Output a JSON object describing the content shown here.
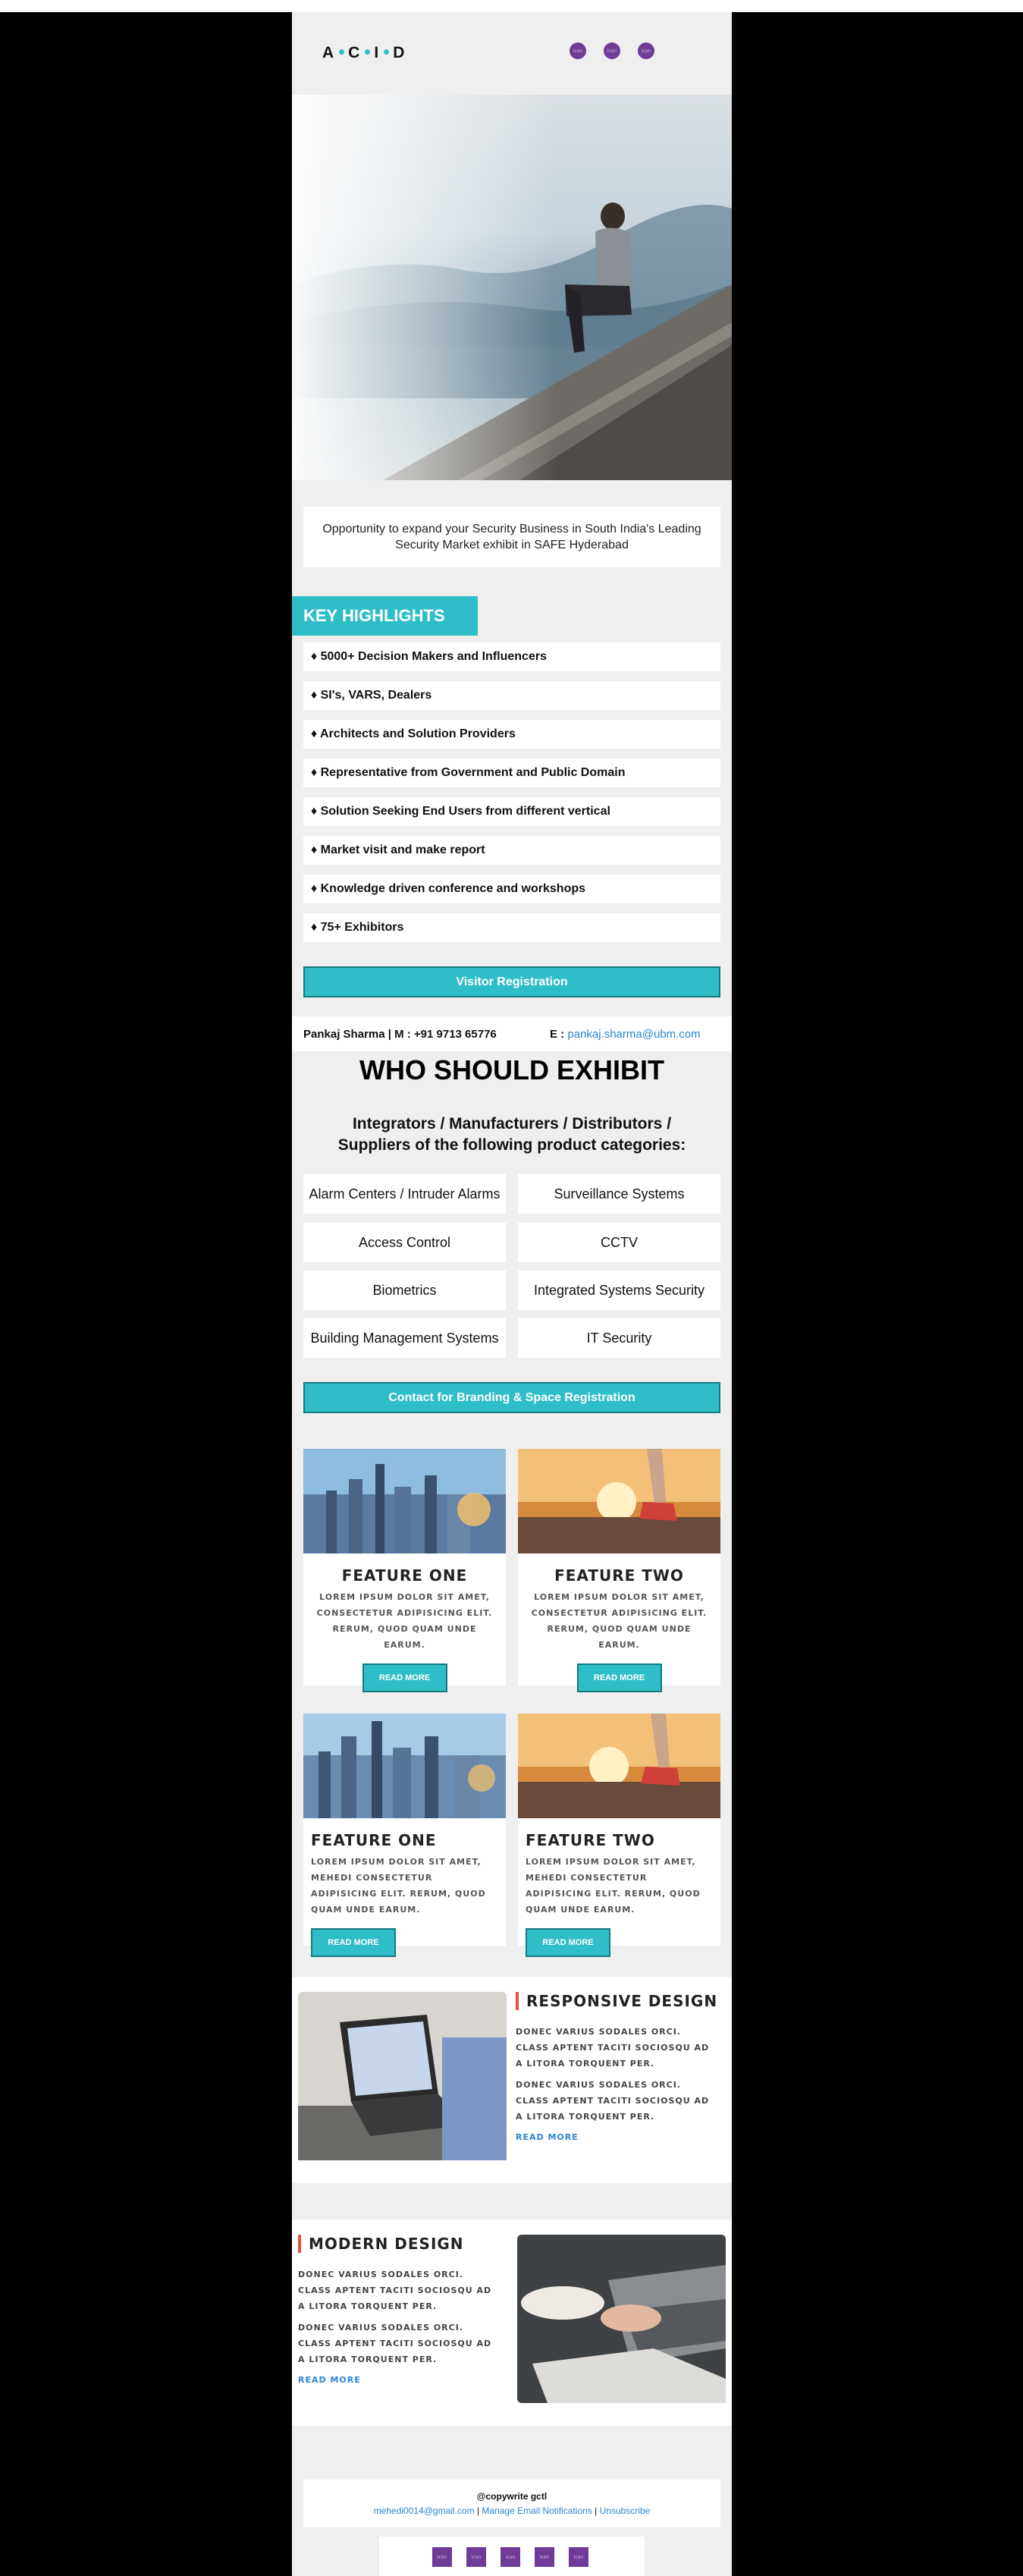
{
  "header": {
    "logo_text": "A•C•I•D",
    "social_icons": [
      "social-icon-1",
      "social-icon-2",
      "social-icon-3"
    ]
  },
  "intro": {
    "text": "Opportunity to expand your Security Business in South India's Leading Security Market exhibit in SAFE Hyderabad"
  },
  "highlights": {
    "title": "KEY HIGHLIGHTS",
    "items": [
      "♦ 5000+ Decision Makers and Influencers",
      "♦ SI's, VARS, Dealers",
      "♦ Architects and Solution Providers",
      "♦ Representative from Government and Public Domain",
      "♦ Solution Seeking End Users from different vertical",
      "♦ Market visit and make report",
      "♦ Knowledge driven conference and workshops",
      "♦ 75+ Exhibitors"
    ]
  },
  "visitor_button": "Visitor Registration",
  "contact": {
    "name": "Pankaj Sharma | M : +91 9713 65776",
    "email_label": "E :",
    "email": "pankaj.sharma@ubm.com"
  },
  "exhibit": {
    "title": "WHO SHOULD EXHIBIT",
    "subtitle": "Integrators / Manufacturers / Distributors / Suppliers of the following product categories:",
    "categories": [
      "Alarm Centers / Intruder Alarms",
      "Surveillance Systems",
      "Access Control",
      "CCTV",
      "Biometrics",
      "Integrated Systems Security",
      "Building Management Systems",
      "IT Security"
    ],
    "cta": "Contact for Branding & Space Registration"
  },
  "features": [
    {
      "title": "FEATURE ONE",
      "text": "LOREM IPSUM DOLOR SIT AMET, CONSECTETUR ADIPISICING ELIT. RERUM, QUOD QUAM UNDE EARUM.",
      "button": "READ MORE"
    },
    {
      "title": "FEATURE TWO",
      "text": "LOREM IPSUM DOLOR SIT AMET, CONSECTETUR ADIPISICING ELIT. RERUM, QUOD QUAM UNDE EARUM.",
      "button": "READ MORE"
    },
    {
      "title": "FEATURE ONE",
      "text": "LOREM IPSUM DOLOR SIT AMET, MEHEDI CONSECTETUR ADIPISICING ELIT. RERUM, QUOD QUAM UNDE EARUM.",
      "button": "READ MORE"
    },
    {
      "title": "FEATURE TWO",
      "text": "LOREM IPSUM DOLOR SIT AMET, MEHEDI CONSECTETUR ADIPISICING ELIT. RERUM, QUOD QUAM UNDE EARUM.",
      "button": "READ MORE"
    }
  ],
  "responsive": {
    "title": "RESPONSIVE DESIGN",
    "p1": "DONEC VARIUS SODALES ORCI. CLASS APTENT TACITI SOCIOSQU AD A LITORA TORQUENT PER.",
    "p2": "DONEC VARIUS SODALES ORCI. CLASS APTENT TACITI SOCIOSQU AD A LITORA TORQUENT PER.",
    "more": "READ MORE"
  },
  "modern": {
    "title": "MODERN DESIGN",
    "p1": "DONEC VARIUS SODALES ORCI. CLASS APTENT TACITI SOCIOSQU AD A LITORA TORQUENT PER.",
    "p2": "DONEC VARIUS SODALES ORCI. CLASS APTENT TACITI SOCIOSQU AD A LITORA TORQUENT PER.",
    "more": "READ MORE"
  },
  "footer": {
    "copyright": "@copywrite gctl",
    "email": "mehedi0014@gmail.com",
    "sep1": " | ",
    "manage": "Manage Email Notifications",
    "sep2": " | ",
    "unsubscribe": "Unsubscribe",
    "social_icons": [
      "footer-social-icon-1",
      "footer-social-icon-2",
      "footer-social-icon-3",
      "footer-social-icon-4",
      "footer-social-icon-5"
    ]
  },
  "colors": {
    "accent": "#2fbec7",
    "social": "#6f3b96",
    "link": "#2a85d4",
    "section_bar": "#e0533a"
  }
}
